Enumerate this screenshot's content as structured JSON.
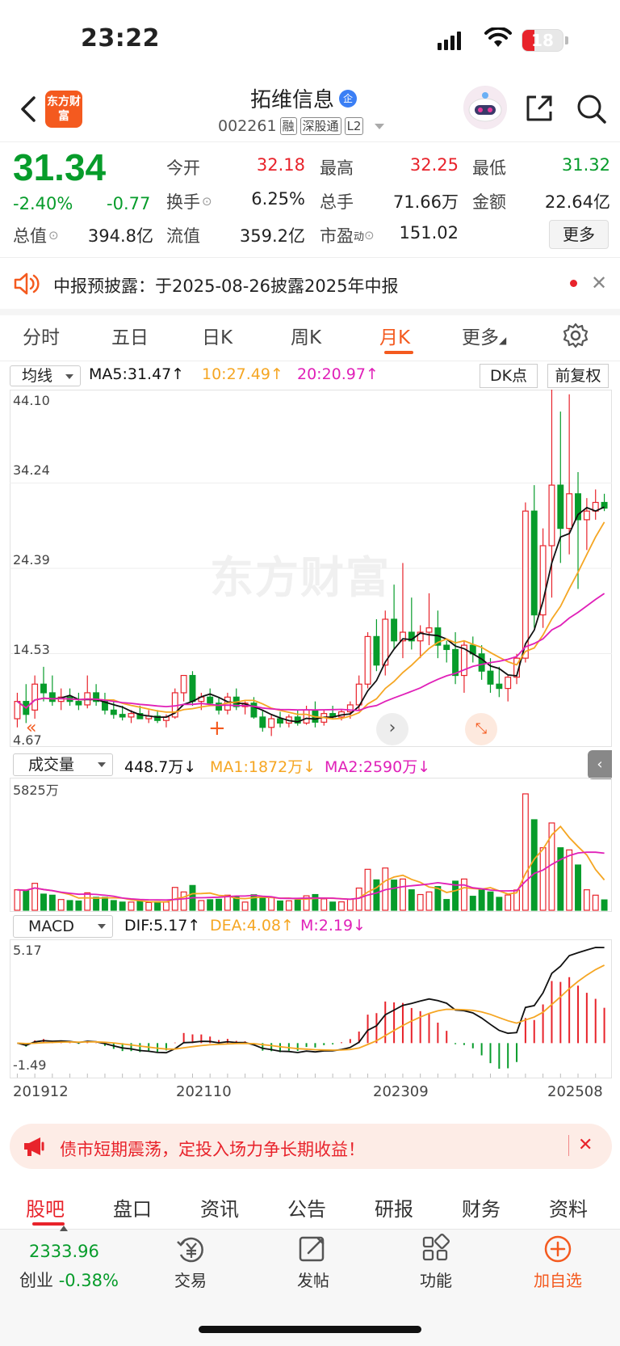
{
  "status_bar": {
    "time": "23:22",
    "battery": "18"
  },
  "header": {
    "logo_text": "东方财富",
    "stock_name": "拓维信息",
    "badge": "企",
    "code": "002261",
    "tags": [
      "融",
      "深股通",
      "L2"
    ]
  },
  "quote": {
    "price": "31.34",
    "change_pct": "-2.40%",
    "change": "-0.77",
    "open_label": "今开",
    "open": "32.18",
    "high_label": "最高",
    "high": "32.25",
    "low_label": "最低",
    "low": "31.32",
    "turnover_label": "换手",
    "turnover": "6.25%",
    "volume_label": "总手",
    "volume": "71.66万",
    "amount_label": "金额",
    "amount": "22.64亿",
    "mktcap_label": "总值",
    "mktcap": "394.8亿",
    "float_label": "流值",
    "float": "359.2亿",
    "pe_label": "市盈",
    "pe_super": "动",
    "pe": "151.02",
    "more": "更多"
  },
  "notice": {
    "text": "中报预披露：于2025-08-26披露2025年中报"
  },
  "tabs": [
    "分时",
    "五日",
    "日K",
    "周K",
    "月K",
    "更多"
  ],
  "active_tab": "月K",
  "chart_controls": {
    "ma_select": "均线",
    "dk": "DK点",
    "adjust": "前复权",
    "vol_select": "成交量",
    "macd_select": "MACD"
  },
  "legends": {
    "ma5": "MA5:31.47↑",
    "ma10": "10:27.49↑",
    "ma20": "20:20.97↑",
    "vol": "448.7万↓",
    "ma1": "MA1:1872万↓",
    "ma2": "MA2:2590万↓",
    "dif": "DIF:5.17↑",
    "dea": "DEA:4.08↑",
    "m": "M:2.19↓"
  },
  "colors": {
    "up": "#e8232b",
    "down": "#079c2b",
    "ma5": "#111111",
    "ma10": "#f5a623",
    "ma20": "#e020b8",
    "brand": "#f45a1f"
  },
  "chart_data": {
    "type": "candlestick",
    "price_axis": [
      "44.10",
      "34.24",
      "24.39",
      "14.53",
      "4.67"
    ],
    "volume_axis_top": "5825万",
    "macd_axis": [
      "5.17",
      "-1.49"
    ],
    "x_ticks": [
      "201912",
      "202110",
      "202309",
      "202508"
    ],
    "ylim": [
      4.67,
      44.1
    ],
    "candles": [
      [
        7,
        10,
        6,
        9
      ],
      [
        9,
        11,
        6.5,
        7.5
      ],
      [
        8,
        12,
        7,
        11
      ],
      [
        11,
        13,
        9,
        10
      ],
      [
        10,
        12,
        8.5,
        9
      ],
      [
        9,
        10.5,
        8,
        9.5
      ],
      [
        9.5,
        10.5,
        8.5,
        9
      ],
      [
        9,
        10,
        8,
        8.6
      ],
      [
        8.6,
        12,
        8.2,
        10
      ],
      [
        10,
        11,
        8.5,
        9
      ],
      [
        9,
        10,
        7.5,
        8
      ],
      [
        8,
        9,
        7,
        7.5
      ],
      [
        7.5,
        8.5,
        6.8,
        7.2
      ],
      [
        7.2,
        8,
        6.5,
        7.6
      ],
      [
        7.6,
        8.5,
        7,
        7
      ],
      [
        7,
        8,
        6.5,
        7.3
      ],
      [
        7.3,
        8,
        6.5,
        6.8
      ],
      [
        6.8,
        7.5,
        6,
        7.2
      ],
      [
        7.2,
        10.5,
        7,
        10
      ],
      [
        10,
        12,
        9,
        12
      ],
      [
        12,
        12.5,
        8.5,
        9
      ],
      [
        9,
        10,
        8,
        9.5
      ],
      [
        9.5,
        10.5,
        8.5,
        8.8
      ],
      [
        8.8,
        9.5,
        7.5,
        8
      ],
      [
        8,
        10,
        7.5,
        9.5
      ],
      [
        9.5,
        10.5,
        8,
        8.4
      ],
      [
        8.4,
        9,
        7.5,
        8.8
      ],
      [
        8.8,
        9.5,
        7,
        7.2
      ],
      [
        7.2,
        8,
        5.5,
        6
      ],
      [
        6,
        7.5,
        5,
        7
      ],
      [
        7,
        7.8,
        6,
        6.5
      ],
      [
        6.5,
        7.5,
        6,
        7.2
      ],
      [
        7.2,
        8,
        6.2,
        6.5
      ],
      [
        6.5,
        8.5,
        6.3,
        8
      ],
      [
        8,
        9,
        6,
        6.6
      ],
      [
        6.6,
        8,
        6.2,
        7.6
      ],
      [
        7.6,
        8.5,
        7,
        7.2
      ],
      [
        7.2,
        8,
        6.8,
        7.8
      ],
      [
        7.8,
        9,
        7,
        8.6
      ],
      [
        8.6,
        12,
        8,
        11
      ],
      [
        11,
        17,
        10.5,
        16.5
      ],
      [
        16.5,
        18.5,
        12.5,
        13.2
      ],
      [
        13.2,
        19.5,
        12,
        18.5
      ],
      [
        18.5,
        22.5,
        15,
        16
      ],
      [
        16,
        25,
        14,
        17
      ],
      [
        17,
        21,
        15,
        16
      ],
      [
        16,
        17.8,
        14,
        17
      ],
      [
        17,
        21.5,
        15.5,
        17.5
      ],
      [
        17.5,
        19.5,
        14,
        15.5
      ],
      [
        15.5,
        16,
        13.5,
        15
      ],
      [
        15,
        17,
        11,
        12
      ],
      [
        12,
        16,
        10,
        15.5
      ],
      [
        15.5,
        16.5,
        13.5,
        14.5
      ],
      [
        14.5,
        15.5,
        11.5,
        12.5
      ],
      [
        12.5,
        14,
        10,
        11
      ],
      [
        11,
        13,
        9.5,
        10.5
      ],
      [
        10.5,
        12,
        9,
        11.8
      ],
      [
        11.8,
        14.5,
        11,
        14
      ],
      [
        14,
        32,
        13.5,
        31
      ],
      [
        31,
        34,
        17.5,
        19
      ],
      [
        19,
        29,
        17.5,
        27
      ],
      [
        27,
        46,
        21,
        34
      ],
      [
        34,
        42.5,
        25,
        29
      ],
      [
        29,
        44.5,
        26,
        33
      ],
      [
        33,
        35.5,
        22,
        30
      ],
      [
        30,
        32.5,
        26.5,
        31
      ],
      [
        31,
        33.5,
        30,
        32
      ],
      [
        32,
        33,
        31,
        31.34
      ]
    ]
  }
}
